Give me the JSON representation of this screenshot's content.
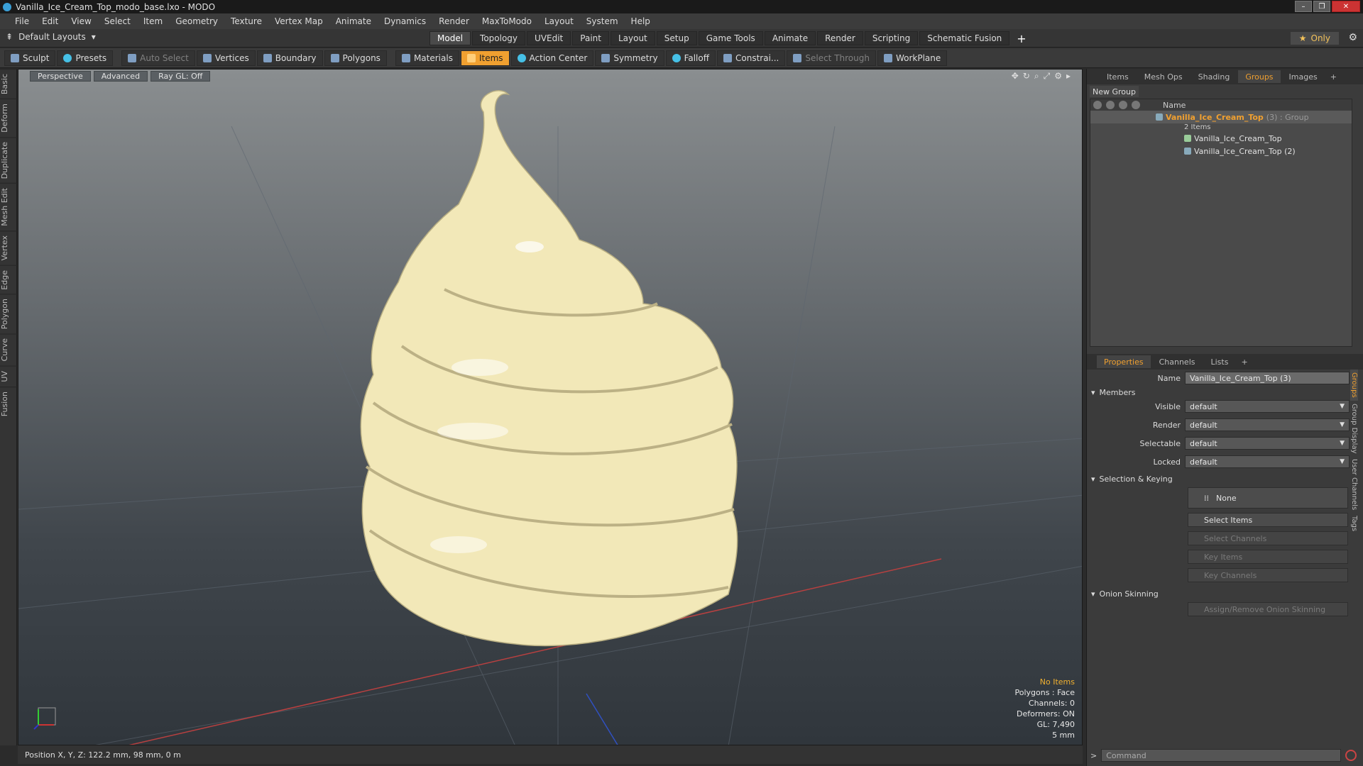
{
  "window": {
    "title": "Vanilla_Ice_Cream_Top_modo_base.lxo - MODO"
  },
  "menu": [
    "File",
    "Edit",
    "View",
    "Select",
    "Item",
    "Geometry",
    "Texture",
    "Vertex Map",
    "Animate",
    "Dynamics",
    "Render",
    "MaxToModo",
    "Layout",
    "System",
    "Help"
  ],
  "layouts": {
    "label": "Default Layouts"
  },
  "tabs": [
    "Model",
    "Topology",
    "UVEdit",
    "Paint",
    "Layout",
    "Setup",
    "Game Tools",
    "Animate",
    "Render",
    "Scripting",
    "Schematic Fusion"
  ],
  "only_label": "Only",
  "toolbar": {
    "sculpt": "Sculpt",
    "presets": "Presets",
    "auto_select": "Auto Select",
    "vertices": "Vertices",
    "boundary": "Boundary",
    "polygons": "Polygons",
    "materials": "Materials",
    "items": "Items",
    "action_center": "Action Center",
    "symmetry": "Symmetry",
    "falloff": "Falloff",
    "constrain": "Constrai...",
    "select_through": "Select Through",
    "workplane": "WorkPlane"
  },
  "left_tabs": [
    "Basic",
    "Deform",
    "Duplicate",
    "Mesh Edit",
    "Vertex",
    "Edge",
    "Polygon",
    "Curve",
    "UV",
    "Fusion"
  ],
  "viewport": {
    "perspective": "Perspective",
    "advanced": "Advanced",
    "raygl": "Ray GL: Off",
    "stats": {
      "no_items": "No Items",
      "polygons": "Polygons : Face",
      "channels": "Channels: 0",
      "deformers": "Deformers: ON",
      "gl": "GL: 7,490",
      "scale": "5 mm"
    },
    "model_color": "#f2e8b8"
  },
  "status": {
    "position": "Position X, Y, Z:  122.2 mm, 98 mm, 0 m"
  },
  "right_tabs": [
    "Items",
    "Mesh Ops",
    "Shading",
    "Groups",
    "Images"
  ],
  "groups": {
    "new_group": "New Group",
    "col_name": "Name",
    "group_name": "Vanilla_Ice_Cream_Top",
    "group_suffix": "(3) : Group",
    "count": "2 Items",
    "children": [
      "Vanilla_Ice_Cream_Top",
      "Vanilla_Ice_Cream_Top (2)"
    ]
  },
  "properties": {
    "tabs": [
      "Properties",
      "Channels",
      "Lists"
    ],
    "name_label": "Name",
    "name_value": "Vanilla_Ice_Cream_Top (3)",
    "members": "Members",
    "visible_label": "Visible",
    "render_label": "Render",
    "selectable_label": "Selectable",
    "locked_label": "Locked",
    "default": "default",
    "selection_keying": "Selection & Keying",
    "none": "None",
    "select_items": "Select Items",
    "select_channels": "Select Channels",
    "key_items": "Key Items",
    "key_channels": "Key Channels",
    "onion_skinning": "Onion Skinning",
    "assign_onion": "Assign/Remove Onion Skinning"
  },
  "side_vtabs": [
    "Groups",
    "Group Display",
    "User Channels",
    "Tags"
  ],
  "command_placeholder": "Command"
}
